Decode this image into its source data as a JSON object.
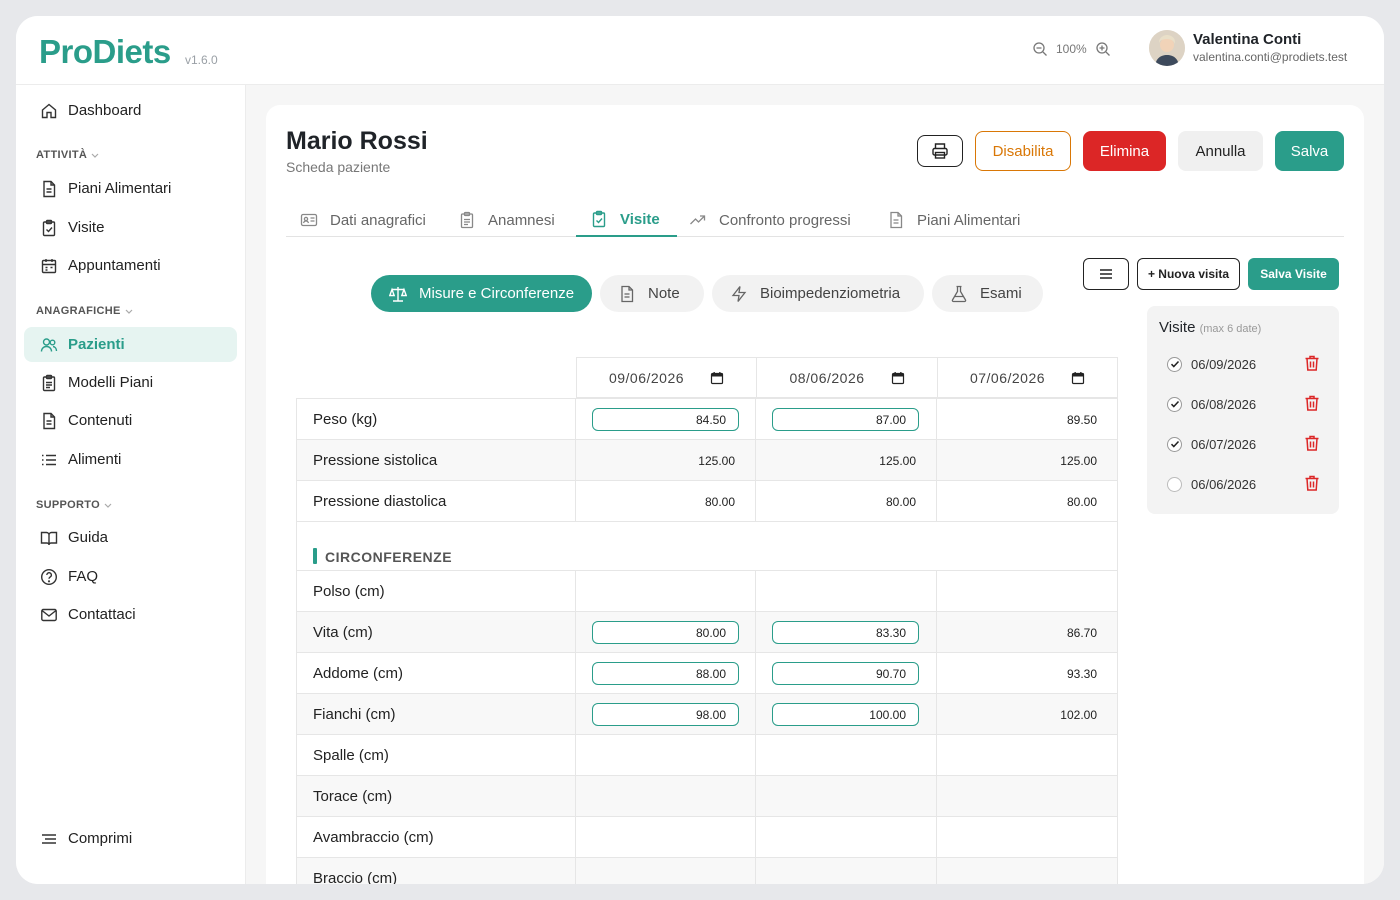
{
  "app": {
    "name": "ProDiets",
    "version": "v1.6.0"
  },
  "zoom": {
    "level": "100%"
  },
  "user": {
    "name": "Valentina Conti",
    "email": "valentina.conti@prodiets.test"
  },
  "sidebar": {
    "dashboard": "Dashboard",
    "sections": {
      "attivita": "ATTIVITÀ",
      "anagrafiche": "ANAGRAFICHE",
      "supporto": "SUPPORTO"
    },
    "attivita": [
      "Piani Alimentari",
      "Visite",
      "Appuntamenti"
    ],
    "anagrafiche": [
      "Pazienti",
      "Modelli Piani",
      "Contenuti",
      "Alimenti"
    ],
    "supporto": [
      "Guida",
      "FAQ",
      "Contattaci"
    ],
    "collapse": "Comprimi"
  },
  "patient": {
    "name": "Mario Rossi",
    "subtitle": "Scheda paziente"
  },
  "actions": {
    "disable": "Disabilita",
    "delete": "Elimina",
    "cancel": "Annulla",
    "save": "Salva"
  },
  "tabs": [
    "Dati anagrafici",
    "Anamnesi",
    "Visite",
    "Confronto progressi",
    "Piani Alimentari"
  ],
  "subtabs": [
    "Misure e Circonferenze",
    "Note",
    "Bioimpedenziometria",
    "Esami"
  ],
  "visit_actions": {
    "new_visit": "+ Nuova visita",
    "save_visits": "Salva Visite"
  },
  "table": {
    "dates": [
      "09/06/2026",
      "08/06/2026",
      "07/06/2026"
    ],
    "section_circ": "CIRCONFERENZE",
    "rows": [
      {
        "label": "Peso (kg)",
        "values": [
          "84.50",
          "87.00",
          "89.50"
        ]
      },
      {
        "label": "Pressione sistolica",
        "values": [
          "125.00",
          "125.00",
          "125.00"
        ]
      },
      {
        "label": "Pressione diastolica",
        "values": [
          "80.00",
          "80.00",
          "80.00"
        ]
      }
    ],
    "circ_rows": [
      {
        "label": "Polso (cm)",
        "values": [
          "",
          "",
          ""
        ]
      },
      {
        "label": "Vita (cm)",
        "values": [
          "80.00",
          "83.30",
          "86.70"
        ]
      },
      {
        "label": "Addome (cm)",
        "values": [
          "88.00",
          "90.70",
          "93.30"
        ]
      },
      {
        "label": "Fianchi (cm)",
        "values": [
          "98.00",
          "100.00",
          "102.00"
        ]
      },
      {
        "label": "Spalle (cm)",
        "values": [
          "",
          "",
          ""
        ]
      },
      {
        "label": "Torace (cm)",
        "values": [
          "",
          "",
          ""
        ]
      },
      {
        "label": "Avambraccio (cm)",
        "values": [
          "",
          "",
          ""
        ]
      },
      {
        "label": "Braccio (cm)",
        "values": [
          "",
          "",
          ""
        ]
      }
    ]
  },
  "visite": {
    "title": "Visite",
    "hint": "(max 6 date)",
    "items": [
      {
        "date": "06/09/2026",
        "checked": true
      },
      {
        "date": "06/08/2026",
        "checked": true
      },
      {
        "date": "06/07/2026",
        "checked": true
      },
      {
        "date": "06/06/2026",
        "checked": false
      }
    ]
  },
  "colors": {
    "accent": "#2a9d8a",
    "danger": "#dc2626",
    "warning": "#d97706"
  }
}
